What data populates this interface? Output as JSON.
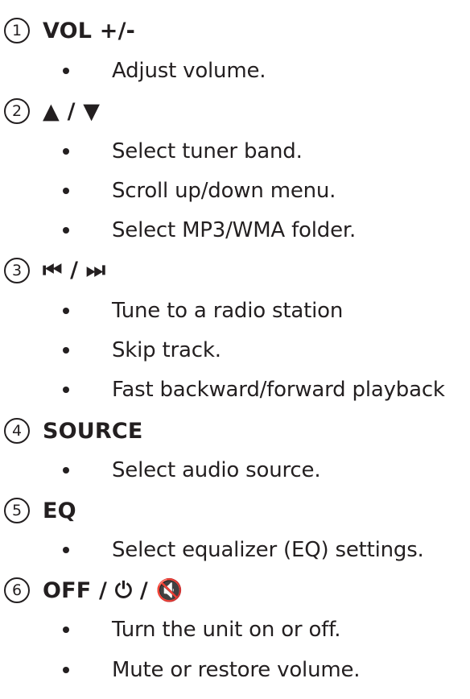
{
  "items": [
    {
      "number": "1",
      "label": "VOL +/-",
      "bullets": [
        "Adjust volume."
      ]
    },
    {
      "number": "2",
      "label": "▲ / ▼",
      "bullets": [
        "Select tuner band.",
        "Scroll up/down menu.",
        "Select MP3/WMA folder."
      ]
    },
    {
      "number": "3",
      "label": "⏮ / ⏭",
      "bullets": [
        "Tune to a radio station",
        "Skip track.",
        "Fast backward/forward playback"
      ]
    },
    {
      "number": "4",
      "label": "SOURCE",
      "bullets": [
        "Select audio source."
      ]
    },
    {
      "number": "5",
      "label": "EQ",
      "bullets": [
        "Select equalizer (EQ) settings."
      ]
    },
    {
      "number": "6",
      "label": "OFF / ⏻ / 🔇",
      "bullets": [
        "Turn the unit on or off.",
        "Mute or restore volume."
      ]
    }
  ]
}
